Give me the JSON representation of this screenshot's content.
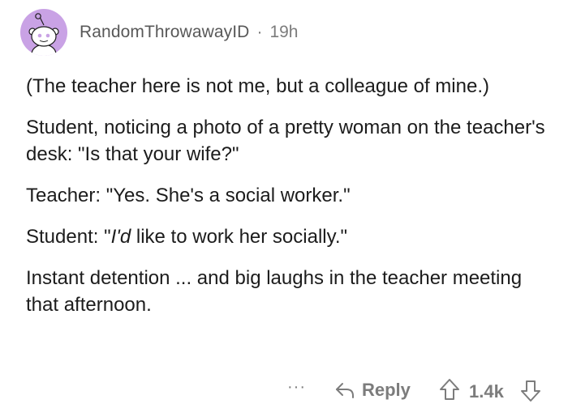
{
  "comment": {
    "username": "RandomThrowawayID",
    "separator": "·",
    "age": "19h",
    "paragraphs": {
      "p1": "(The teacher here is not me, but a colleague of mine.)",
      "p2": "Student, noticing a photo of a pretty woman on the teacher's desk: \"Is that your wife?\"",
      "p3": "Teacher: \"Yes. She's a social worker.\"",
      "p4_prefix": "Student: \"",
      "p4_italic": "I'd",
      "p4_suffix": " like to work her socially.\"",
      "p5": "Instant detention ... and big laughs in the teacher meeting that afternoon."
    }
  },
  "actions": {
    "more_label": "···",
    "reply_label": "Reply",
    "score": "1.4k"
  },
  "colors": {
    "avatar_bg": "#c9a2e5",
    "meta_text": "#7c7c7c",
    "body_text": "#1c1c1c"
  },
  "icons": {
    "avatar": "reddit-snoo-avatar-icon",
    "reply": "reply-arrow-icon",
    "upvote": "upvote-arrow-icon",
    "downvote": "downvote-arrow-icon"
  }
}
